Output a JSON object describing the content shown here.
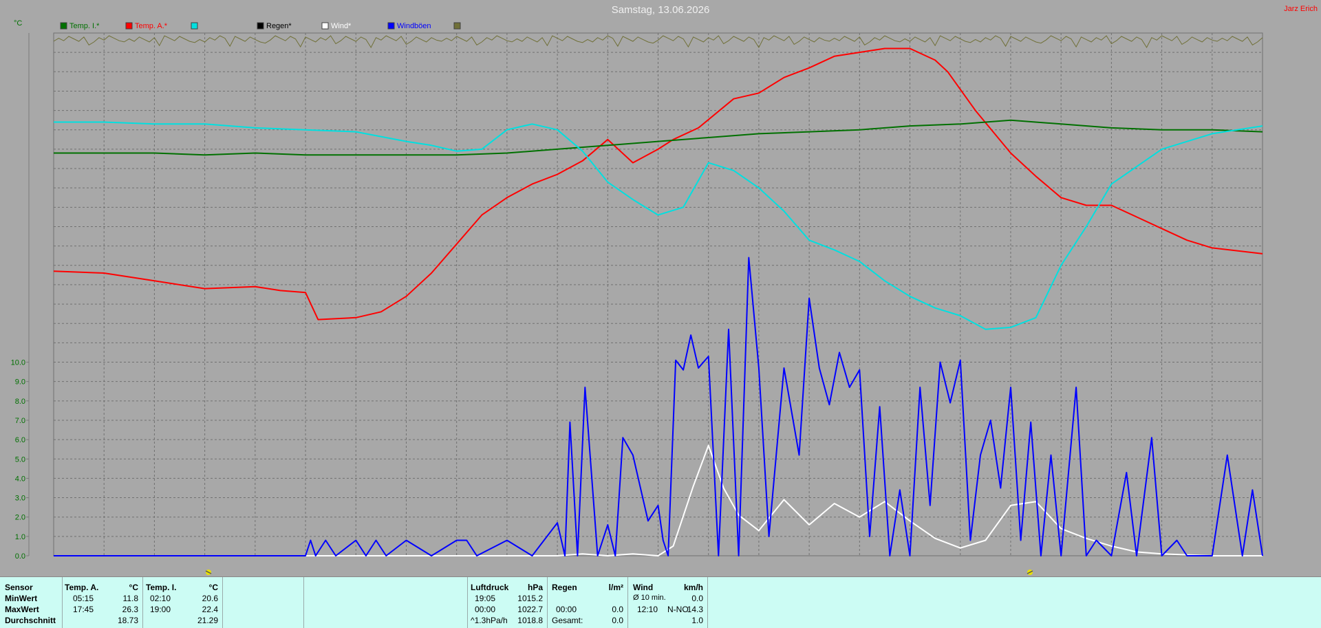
{
  "header": {
    "date": "Samstag, 13.06.2026",
    "author": "Jarz Erich",
    "unit": "°C"
  },
  "colors": {
    "temp_inside": "#007000",
    "temp_outside": "#ff0000",
    "series3": "#00e0e0",
    "rain": "#000000",
    "wind": "#ffffff",
    "gusts": "#0000ff",
    "series7": "#707038"
  },
  "chart_data": {
    "type": "line",
    "title": "Samstag, 13.06.2026",
    "ylabel": "°C",
    "ylim": [
      0,
      27
    ],
    "y_ticks": [
      "0.0",
      "1.0",
      "2.0",
      "3.0",
      "4.0",
      "5.0",
      "6.0",
      "7.0",
      "8.0",
      "9.0",
      "10.0"
    ],
    "grid": true,
    "legend_position": "top-left",
    "legend": [
      {
        "label": "Temp. I.*",
        "color": "#007000"
      },
      {
        "label": "Temp. A.*",
        "color": "#ff0000"
      },
      {
        "label": "",
        "color": "#00e0e0"
      },
      {
        "label": "Regen*",
        "color": "#000000"
      },
      {
        "label": "Wind*",
        "color": "#ffffff"
      },
      {
        "label": "Windböen",
        "color": "#0000ff"
      },
      {
        "label": "",
        "color": "#707038"
      }
    ],
    "x_hours": [
      0,
      24
    ],
    "series": [
      {
        "name": "Temp. A.*",
        "color": "#ff0000",
        "x": [
          0,
          1,
          2,
          3,
          4,
          4.5,
          5,
          5.25,
          6,
          6.5,
          7,
          7.5,
          8,
          8.5,
          9,
          9.5,
          10,
          10.5,
          11,
          11.5,
          12,
          12.3,
          12.8,
          13.5,
          14,
          14.5,
          15,
          15.5,
          16,
          16.5,
          17,
          17.5,
          17.75,
          18.3,
          19,
          19.5,
          20,
          20.5,
          21,
          21.5,
          22,
          22.5,
          23,
          24
        ],
        "y": [
          14.7,
          14.6,
          14.2,
          13.8,
          13.9,
          13.7,
          13.6,
          12.2,
          12.3,
          12.6,
          13.4,
          14.6,
          16.1,
          17.6,
          18.5,
          19.2,
          19.7,
          20.4,
          21.5,
          20.3,
          21.0,
          21.5,
          22.1,
          23.6,
          23.9,
          24.7,
          25.2,
          25.8,
          26.0,
          26.2,
          26.2,
          25.6,
          25.0,
          23.0,
          20.8,
          19.6,
          18.5,
          18.1,
          18.1,
          17.5,
          16.9,
          16.3,
          15.9,
          15.6
        ]
      },
      {
        "name": "Temp. I.*",
        "color": "#007000",
        "x": [
          0,
          2,
          3,
          4,
          5,
          6,
          7,
          8,
          9,
          10,
          11,
          12,
          13,
          14,
          15,
          16,
          17,
          18,
          19,
          20,
          21,
          22,
          23,
          24
        ],
        "y": [
          20.8,
          20.8,
          20.7,
          20.8,
          20.7,
          20.7,
          20.7,
          20.7,
          20.8,
          21.0,
          21.2,
          21.4,
          21.6,
          21.8,
          21.9,
          22.0,
          22.2,
          22.3,
          22.5,
          22.3,
          22.1,
          22.0,
          22.0,
          21.9
        ]
      },
      {
        "name": "",
        "color": "#00e0e0",
        "x": [
          0,
          1,
          2,
          3,
          4,
          5,
          6,
          7,
          7.5,
          8,
          8.5,
          9,
          9.5,
          10,
          10.5,
          11,
          11.5,
          12,
          12.5,
          13,
          13.5,
          14,
          14.5,
          15,
          15.5,
          16,
          16.5,
          17,
          17.5,
          18,
          18.5,
          19,
          19.5,
          20,
          20.5,
          21,
          22,
          23,
          24
        ],
        "y": [
          22.4,
          22.4,
          22.3,
          22.3,
          22.1,
          22.0,
          21.9,
          21.4,
          21.2,
          20.9,
          21.0,
          22.0,
          22.3,
          22.0,
          20.9,
          19.3,
          18.4,
          17.6,
          18.0,
          20.3,
          19.9,
          19.0,
          17.8,
          16.3,
          15.8,
          15.2,
          14.2,
          13.4,
          12.8,
          12.4,
          11.7,
          11.8,
          12.3,
          15.0,
          17.0,
          19.2,
          21.0,
          21.8,
          22.2
        ]
      },
      {
        "name": "Wind*",
        "color": "#ffffff",
        "x": [
          0,
          10,
          10.5,
          11,
          11.5,
          12,
          12.3,
          12.7,
          13,
          13.3,
          13.6,
          14,
          14.5,
          15,
          15.5,
          16,
          16.5,
          17,
          17.5,
          18,
          18.5,
          19,
          19.5,
          20,
          20.5,
          21,
          21.5,
          22,
          23,
          24
        ],
        "y": [
          0,
          0,
          0.1,
          0,
          0.1,
          0,
          0.5,
          3.6,
          5.7,
          3.5,
          2.1,
          1.3,
          2.9,
          1.6,
          2.7,
          2.0,
          2.8,
          1.8,
          0.9,
          0.4,
          0.8,
          2.6,
          2.8,
          1.4,
          0.9,
          0.5,
          0.2,
          0.1,
          0,
          0
        ]
      },
      {
        "name": "Windböen",
        "color": "#0000ff",
        "x": [
          0,
          5,
          5.1,
          5.2,
          5.4,
          5.6,
          6,
          6.2,
          6.4,
          6.6,
          7,
          7.5,
          8,
          8.2,
          8.4,
          9,
          9.5,
          10,
          10.15,
          10.25,
          10.4,
          10.55,
          10.8,
          11,
          11.15,
          11.3,
          11.5,
          11.8,
          12,
          12.1,
          12.2,
          12.35,
          12.5,
          12.65,
          12.8,
          13,
          13.2,
          13.4,
          13.6,
          13.8,
          14,
          14.2,
          14.5,
          14.8,
          15,
          15.2,
          15.4,
          15.6,
          15.8,
          16,
          16.2,
          16.4,
          16.6,
          16.8,
          17,
          17.2,
          17.4,
          17.6,
          17.8,
          18,
          18.2,
          18.4,
          18.6,
          18.8,
          19,
          19.2,
          19.4,
          19.6,
          19.8,
          20,
          20.3,
          20.5,
          20.7,
          21,
          21.3,
          21.5,
          21.8,
          22,
          22.3,
          22.5,
          23,
          23.3,
          23.6,
          23.8,
          24
        ],
        "y": [
          0,
          0,
          0.8,
          0,
          0.8,
          0,
          0.8,
          0,
          0.8,
          0,
          0.8,
          0,
          0.8,
          0.8,
          0,
          0.8,
          0,
          1.7,
          0,
          6.9,
          0,
          8.7,
          0,
          1.6,
          0,
          6.1,
          5.2,
          1.8,
          2.6,
          0.8,
          0,
          10.1,
          9.6,
          11.4,
          9.7,
          10.3,
          0,
          11.7,
          0,
          15.4,
          9.7,
          1.0,
          9.7,
          5.2,
          13.3,
          9.7,
          7.8,
          10.5,
          8.7,
          9.6,
          1.0,
          7.7,
          0,
          3.4,
          0,
          8.7,
          2.6,
          10.0,
          7.9,
          10.1,
          0.8,
          5.2,
          7.0,
          3.5,
          8.7,
          0.8,
          6.9,
          0,
          5.2,
          0,
          8.7,
          0,
          0.8,
          0,
          4.3,
          0,
          6.1,
          0,
          0.8,
          0,
          0,
          5.2,
          0,
          3.4,
          0
        ]
      }
    ]
  },
  "stats": {
    "sensor": {
      "header": "Sensor",
      "rows": [
        "MinWert",
        "MaxWert",
        "Durchschnitt"
      ]
    },
    "temp_a": {
      "header": "Temp. A.",
      "unit": "°C",
      "times": [
        "05:15",
        "17:45",
        ""
      ],
      "values": [
        "11.8",
        "26.3",
        "18.73"
      ]
    },
    "temp_i": {
      "header": "Temp. I.",
      "unit": "°C",
      "times": [
        "02:10",
        "19:00",
        ""
      ],
      "values": [
        "20.6",
        "22.4",
        "21.29"
      ]
    },
    "pressure": {
      "header": "Luftdruck",
      "unit": "hPa",
      "times": [
        "19:05",
        "00:00",
        "^1.3hPa/h"
      ],
      "values": [
        "1015.2",
        "1022.7",
        "1018.8"
      ]
    },
    "rain": {
      "header": "Regen",
      "unit": "l/m²",
      "times": [
        "",
        "00:00",
        "Gesamt:"
      ],
      "values": [
        "",
        "0.0",
        "0.0"
      ]
    },
    "wind": {
      "header": "Wind",
      "unit": "km/h",
      "times": [
        "Ø 10 min.",
        "12:10",
        ""
      ],
      "dirs": [
        "",
        "N-NO",
        ""
      ],
      "values": [
        "0.0",
        "14.3",
        "1.0"
      ]
    }
  }
}
